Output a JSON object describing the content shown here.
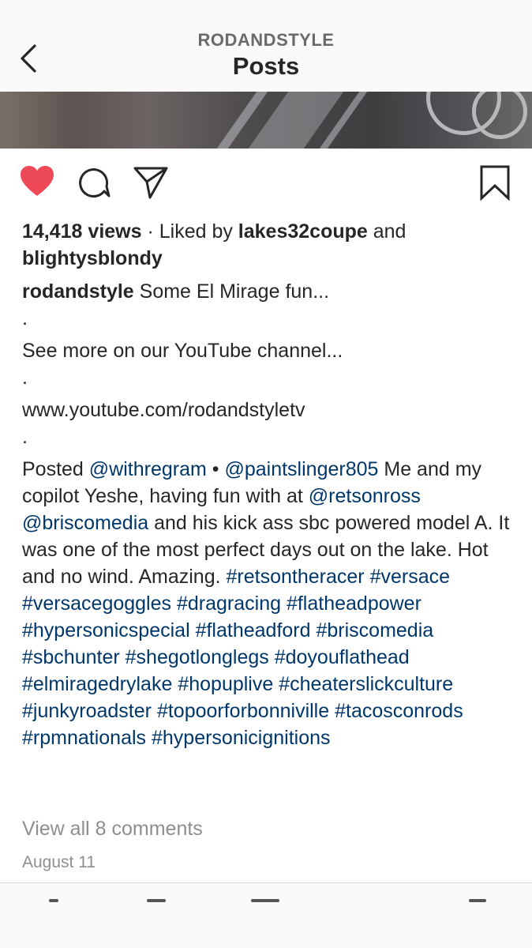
{
  "header": {
    "username": "RODANDSTYLE",
    "title": "Posts"
  },
  "icons": {
    "back": "chevron-left-icon",
    "like": "heart-filled-icon",
    "comment": "comment-bubble-icon",
    "share": "paper-plane-icon",
    "save": "bookmark-icon"
  },
  "colors": {
    "like": "#ed4956",
    "hashtag": "#00376b",
    "muted": "#8e8e8e"
  },
  "stats": {
    "views": "14,418 views",
    "sep": " · Liked by ",
    "liker1": "lakes32coupe",
    "and": " and",
    "liker2": "blightysblondy"
  },
  "caption": {
    "author": "rodandstyle",
    "line1": " Some El Mirage fun...",
    "dot": ".",
    "line2": "See more on our YouTube channel...",
    "line3": "www.youtube.com/rodandstyletv",
    "posted": "Posted ",
    "mention1": "@withregram",
    "bullet": " • ",
    "mention2": "@paintslinger805",
    "text1": " Me and my copilot Yeshe, having fun with at ",
    "mention3": "@retsonross",
    "space": " ",
    "mention4": "@briscomedia",
    "text2": " and his kick ass sbc powered model A. It was one of the most perfect days out on the lake. Hot and no wind. Amazing.  ",
    "hashtags": [
      "#retsontheracer",
      "#versace",
      "#versacegoggles",
      "#dragracing",
      "#flatheadpower",
      "#hypersonicspecial",
      "#flatheadford",
      "#briscomedia",
      "#sbchunter",
      "#shegotlonglegs",
      "#doyouflathead",
      "#elmiragedrylake",
      "#hopuplive",
      "#cheaterslickculture",
      "#junkyroadster",
      "#topoorforbonniville",
      "#tacosconrods",
      "#rpmnationals",
      "#hypersonicignitions"
    ]
  },
  "comments_link": "View all 8 comments",
  "date": "August 11"
}
